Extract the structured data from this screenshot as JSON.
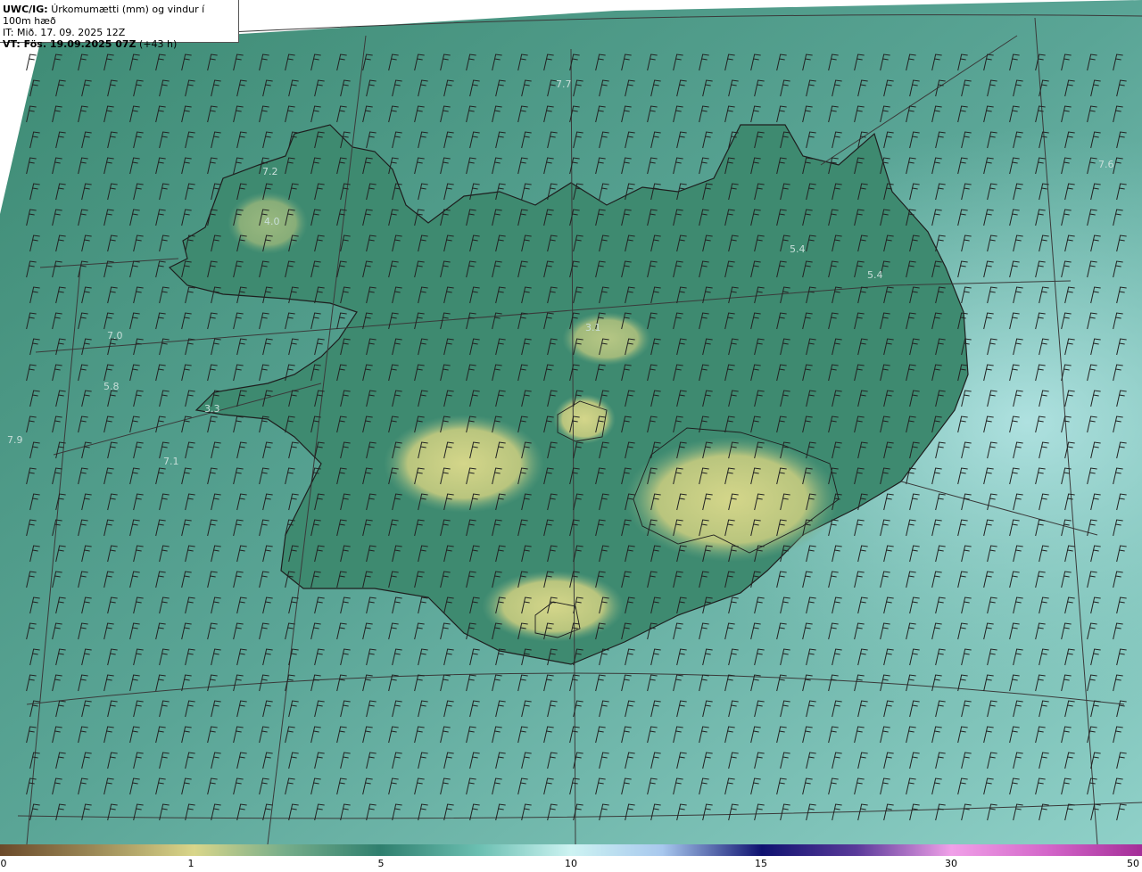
{
  "header": {
    "model": "UWC/IG:",
    "title": "Úrkomumætti (mm) og vindur í 100m hæð",
    "it_line": "IT: Mið. 17. 09. 2025 12Z",
    "vt_prefix": "VT: Fös. 19.09.2025 07Z",
    "vt_suffix": "(+43 h)"
  },
  "map_labels": [
    "7.7",
    "7.2",
    "4.0",
    "7.0",
    "5.8",
    "3.3",
    "7.9",
    "7.1",
    "3.1",
    "5.4",
    "5.4",
    "7.6"
  ],
  "colorbar": {
    "ticks": [
      "0",
      "1",
      "5",
      "10",
      "15",
      "30",
      "50"
    ],
    "colors": [
      "#6b4a2a",
      "#9c8a55",
      "#d9d68a",
      "#5d9e86",
      "#2f7f6e",
      "#8fd8d2",
      "#bfeff0",
      "#2a2f8a",
      "#0f1270",
      "#8a3a9a",
      "#e07ad8",
      "#b83aa8"
    ]
  },
  "colors": {
    "ocean": "#5a9e8e",
    "land_low": "#3f8a72",
    "land_high": "#c9cf80",
    "coast": "#222222",
    "grid": "#3a3a3a"
  }
}
